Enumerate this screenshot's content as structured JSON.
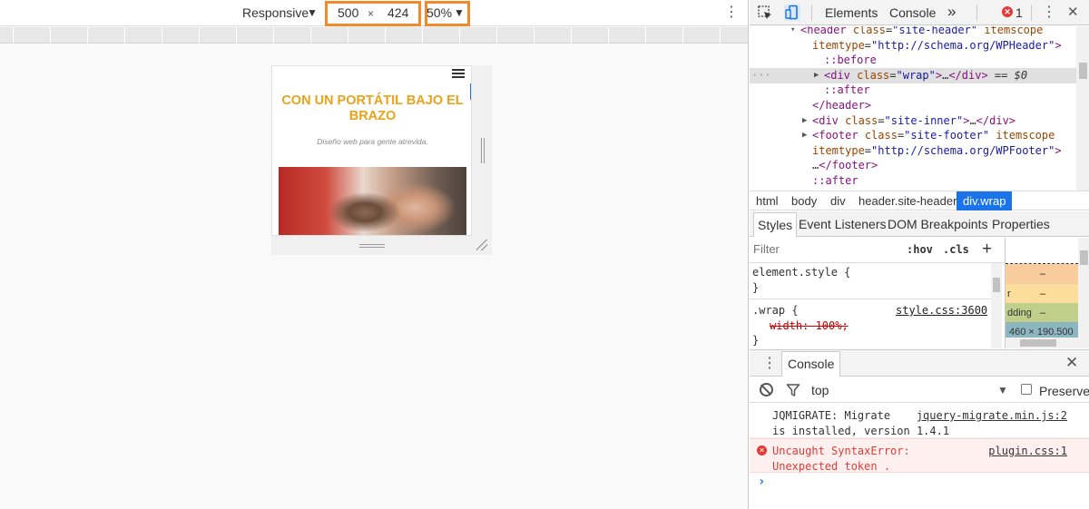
{
  "device_toolbar": {
    "mode": "Responsive",
    "width": "500",
    "times": "×",
    "height": "424",
    "zoom": "50%"
  },
  "site": {
    "title": "CON UN PORTÁTIL BAJO EL BRAZO",
    "description": "Diseño web para gente atrevida."
  },
  "devtools": {
    "tabs": [
      "Elements",
      "Console"
    ],
    "more_tabs": "»",
    "error_count": "1",
    "dom": [
      {
        "indent": 2,
        "arrow": "▾",
        "html": "<span class='tag'>&lt;header</span> <span class='attr'>class</span>=<span class='val'>\"site-header\"</span> <span class='attr'>itemscope</span>"
      },
      {
        "indent": 3,
        "arrow": "",
        "html": "<span class='attr'>itemtype</span>=<span class='val'>\"http://schema.org/WPHeader\"</span><span class='tag'>&gt;</span>"
      },
      {
        "indent": 4,
        "arrow": "",
        "html": "<span class='pseudo'>::before</span>"
      },
      {
        "indent": 4,
        "arrow": "▶",
        "html": "<span class='tag'>&lt;div</span> <span class='attr'>class</span>=<span class='val'>\"wrap\"</span><span class='tag'>&gt;</span>…<span class='tag'>&lt;/div&gt;</span> == <i>$0</i>",
        "selected": true
      },
      {
        "indent": 4,
        "arrow": "",
        "html": "<span class='pseudo'>::after</span>"
      },
      {
        "indent": 3,
        "arrow": "",
        "html": "<span class='tag'>&lt;/header&gt;</span>"
      },
      {
        "indent": 3,
        "arrow": "▶",
        "html": "<span class='tag'>&lt;div</span> <span class='attr'>class</span>=<span class='val'>\"site-inner\"</span><span class='tag'>&gt;</span>…<span class='tag'>&lt;/div&gt;</span>"
      },
      {
        "indent": 3,
        "arrow": "▶",
        "html": "<span class='tag'>&lt;footer</span> <span class='attr'>class</span>=<span class='val'>\"site-footer\"</span> <span class='attr'>itemscope</span>"
      },
      {
        "indent": 3,
        "arrow": "",
        "html": "<span class='attr'>itemtype</span>=<span class='val'>\"http://schema.org/WPFooter\"</span><span class='tag'>&gt;</span>"
      },
      {
        "indent": 3,
        "arrow": "",
        "html": "…<span class='tag'>&lt;/footer&gt;</span>"
      },
      {
        "indent": 3,
        "arrow": "",
        "html": "<span class='pseudo'>::after</span>"
      }
    ],
    "breadcrumb": [
      "html",
      "body",
      "div",
      "header.site-header",
      "div.wrap"
    ],
    "styles_tabs": [
      "Styles",
      "Event Listeners",
      "DOM Breakpoints",
      "Properties"
    ],
    "filter_placeholder": "Filter",
    "hov": ":hov",
    "cls": ".cls",
    "plus": "+",
    "rules": {
      "element_style_selector": "element.style {",
      "close_brace": "}",
      "wrap_selector": ".wrap {",
      "wrap_source": "style.css:3600",
      "wrap_prop": "width: 100%;"
    },
    "box_model": {
      "margin_label": "",
      "border_label": "r",
      "padding_label": "dding",
      "dash": "–",
      "content_size": "460 × 190.500"
    }
  },
  "console": {
    "tab": "Console",
    "context": "top",
    "preserve_label": "Preserve",
    "messages": [
      {
        "text": "JQMIGRATE: Migrate\nis installed, version 1.4.1",
        "source": "jquery-migrate.min.js:2"
      },
      {
        "text": "Uncaught SyntaxError:\nUnexpected token .",
        "source": "plugin.css:1"
      }
    ],
    "prompt": "›"
  }
}
